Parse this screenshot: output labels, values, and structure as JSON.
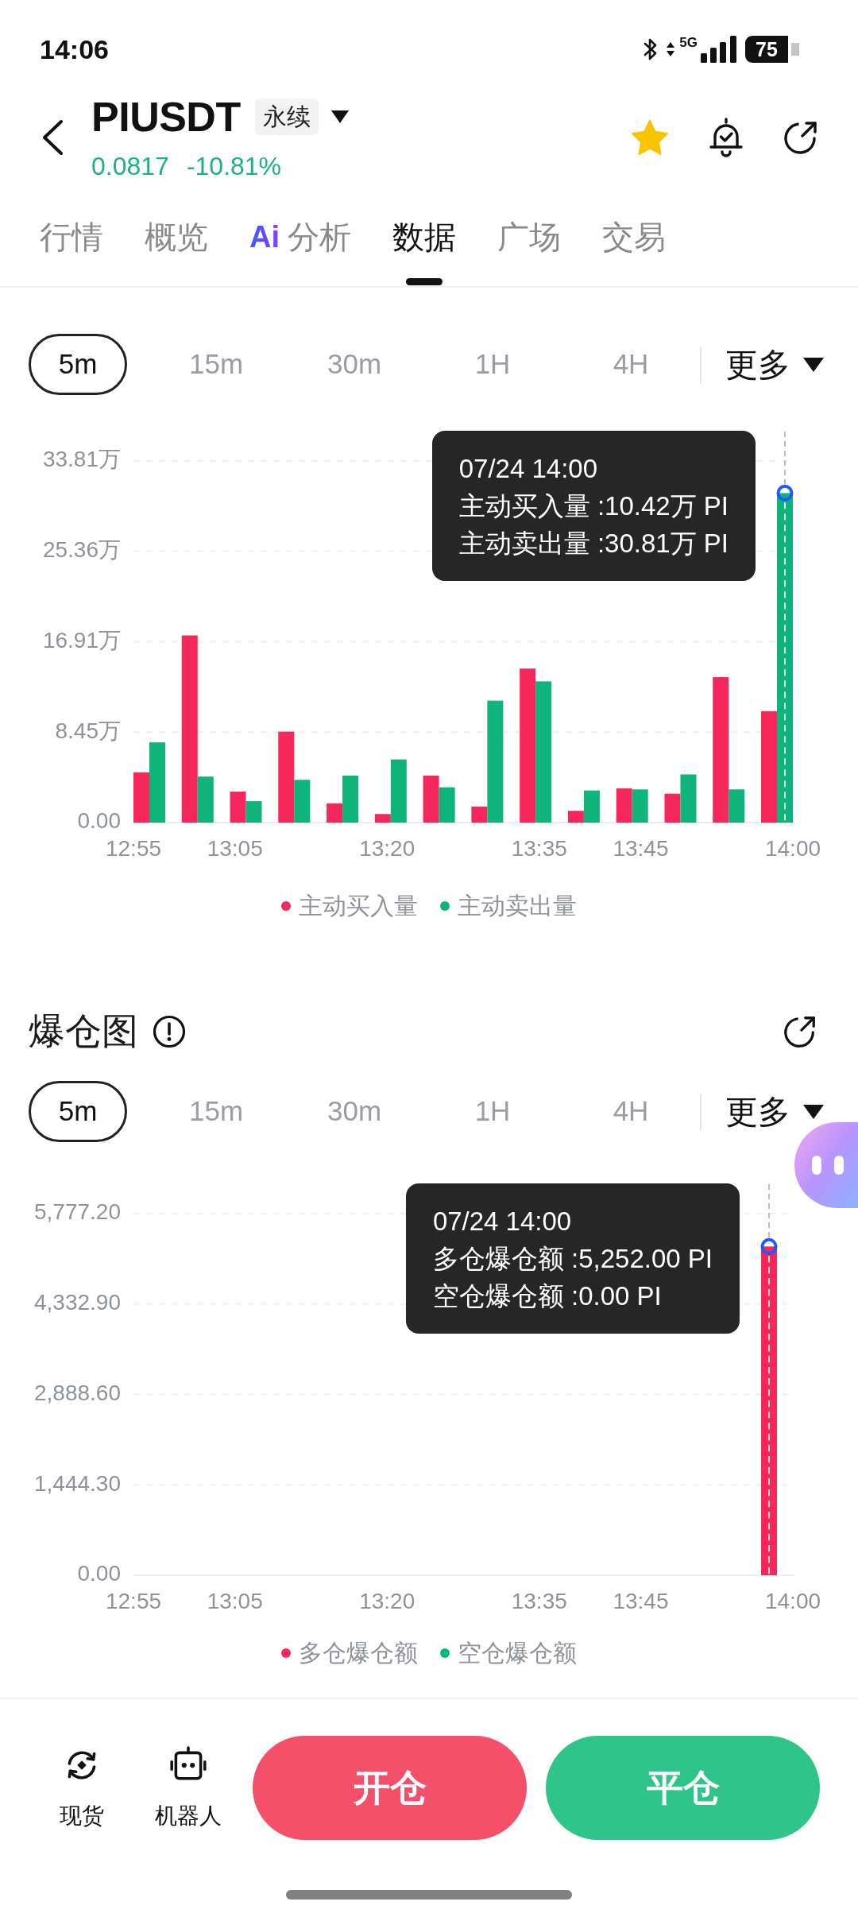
{
  "status_bar": {
    "time": "14:06",
    "network": "5G",
    "battery": "75"
  },
  "header": {
    "symbol": "PIUSDT",
    "contract_type": "永续",
    "price": "0.0817",
    "change": "-10.81%",
    "favorited": true
  },
  "tabs": [
    {
      "label": "行情",
      "selected": false
    },
    {
      "label": "概览",
      "selected": false
    },
    {
      "label": "分析",
      "prefix": "Ai",
      "selected": false
    },
    {
      "label": "数据",
      "selected": true
    },
    {
      "label": "广场",
      "selected": false
    },
    {
      "label": "交易",
      "selected": false
    }
  ],
  "sections": [
    {
      "intervals": [
        {
          "label": "5m",
          "selected": true
        },
        {
          "label": "15m",
          "selected": false
        },
        {
          "label": "30m",
          "selected": false
        },
        {
          "label": "1H",
          "selected": false
        },
        {
          "label": "4H",
          "selected": false
        }
      ],
      "more": "更多",
      "chart_data": {
        "type": "bar",
        "categories": [
          "12:55",
          null,
          "13:05",
          null,
          null,
          "13:20",
          null,
          null,
          "13:35",
          null,
          "13:45",
          null,
          null,
          "14:00"
        ],
        "series": [
          {
            "name": "主动买入量",
            "color": "#f6285b",
            "values": [
              4.7,
              17.5,
              2.9,
              8.5,
              1.8,
              0.8,
              4.4,
              1.5,
              14.4,
              1.1,
              3.2,
              2.7,
              13.6,
              10.42
            ]
          },
          {
            "name": "主动卖出量",
            "color": "#0fb47a",
            "values": [
              7.5,
              4.3,
              2.0,
              4.0,
              4.4,
              5.9,
              3.3,
              11.4,
              13.2,
              3.0,
              3.1,
              4.5,
              3.1,
              30.81
            ]
          }
        ],
        "ylim": [
          0,
          33.81
        ],
        "yticks": [
          {
            "value": 0,
            "label": "0.00"
          },
          {
            "value": 8.45,
            "label": "8.45万"
          },
          {
            "value": 16.91,
            "label": "16.91万"
          },
          {
            "value": 25.36,
            "label": "25.36万"
          },
          {
            "value": 33.81,
            "label": "33.81万"
          }
        ],
        "grid": true
      },
      "tooltip": {
        "title": "07/24 14:00",
        "lines": [
          "主动买入量 :10.42万 PI",
          "主动卖出量 :30.81万 PI"
        ]
      }
    },
    {
      "title": "爆仓图",
      "intervals": [
        {
          "label": "5m",
          "selected": true
        },
        {
          "label": "15m",
          "selected": false
        },
        {
          "label": "30m",
          "selected": false
        },
        {
          "label": "1H",
          "selected": false
        },
        {
          "label": "4H",
          "selected": false
        }
      ],
      "more": "更多",
      "chart_data": {
        "type": "bar",
        "categories": [
          "12:55",
          null,
          "13:05",
          null,
          null,
          "13:20",
          null,
          null,
          "13:35",
          null,
          "13:45",
          null,
          null,
          "14:00"
        ],
        "series": [
          {
            "name": "多仓爆仓额",
            "color": "#f6285b",
            "values": [
              0,
              0,
              0,
              0,
              0,
              0,
              0,
              0,
              0,
              0,
              0,
              0,
              0,
              5252
            ]
          },
          {
            "name": "空仓爆仓额",
            "color": "#0fb47a",
            "values": [
              0,
              0,
              0,
              0,
              0,
              0,
              0,
              0,
              0,
              0,
              0,
              0,
              0,
              0
            ]
          }
        ],
        "ylim": [
          0,
          5777.2
        ],
        "yticks": [
          {
            "value": 0,
            "label": "0.00"
          },
          {
            "value": 1444.3,
            "label": "1,444.30"
          },
          {
            "value": 2888.6,
            "label": "2,888.60"
          },
          {
            "value": 4332.9,
            "label": "4,332.90"
          },
          {
            "value": 5777.2,
            "label": "5,777.20"
          }
        ],
        "grid": true
      },
      "tooltip": {
        "title": "07/24 14:00",
        "lines": [
          "多仓爆仓额 :5,252.00 PI",
          "空仓爆仓额 :0.00 PI"
        ]
      }
    }
  ],
  "bottom_bar": {
    "shortcuts": [
      {
        "kind": "spot",
        "label": "现货"
      },
      {
        "kind": "robot",
        "label": "机器人"
      }
    ],
    "buttons": [
      {
        "kind": "open",
        "label": "开仓"
      },
      {
        "kind": "close",
        "label": "平仓"
      }
    ]
  }
}
